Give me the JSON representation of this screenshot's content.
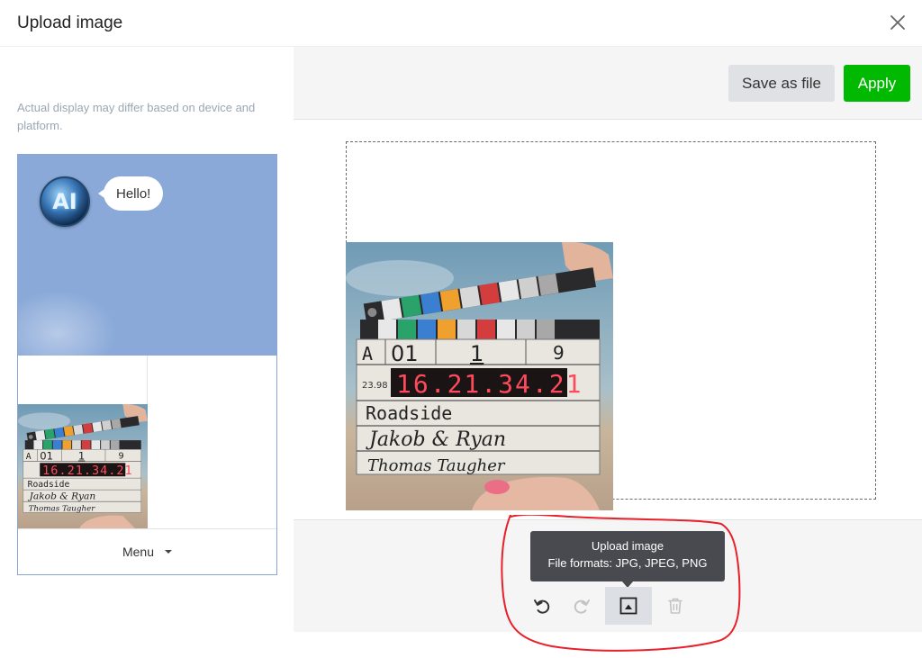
{
  "dialog": {
    "title": "Upload image",
    "close_icon": "close-icon"
  },
  "preview": {
    "note": "Actual display may differ based on device and platform.",
    "chat_bubble": "Hello!",
    "avatar_text": "AI",
    "menu_label": "Menu"
  },
  "toolbar": {
    "save_label": "Save as file",
    "apply_label": "Apply"
  },
  "tooltip": {
    "line1": "Upload image",
    "line2": "File formats: JPG, JPEG, PNG"
  },
  "tools": [
    {
      "name": "undo",
      "icon": "undo-icon",
      "enabled": true
    },
    {
      "name": "redo",
      "icon": "redo-icon",
      "enabled": false
    },
    {
      "name": "upload",
      "icon": "image-upload-icon",
      "enabled": true,
      "active": true
    },
    {
      "name": "delete",
      "icon": "trash-icon",
      "enabled": false
    }
  ],
  "slate": {
    "roll": "A",
    "scene": "01",
    "shot": "1",
    "take": "9",
    "fps": "23.98",
    "timecode": "16.21.34.21",
    "title": "Roadside",
    "director": "Jakob & Ryan",
    "camera": "Thomas Taugher"
  },
  "colors": {
    "apply_green": "#00b900",
    "preview_bg": "#8aa9d8",
    "annotation_red": "#e8202a",
    "tooltip_bg": "#484a50"
  }
}
